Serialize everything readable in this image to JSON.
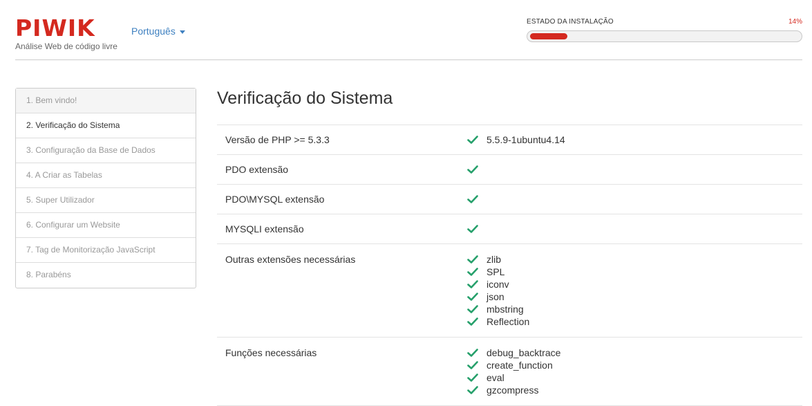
{
  "header": {
    "logo_text": "PIWIK",
    "tagline": "Análise Web de código livre",
    "language": "Português"
  },
  "progress": {
    "label": "ESTADO DA INSTALAÇÃO",
    "percent_text": "14%",
    "value": 0.14
  },
  "colors": {
    "brand": "#d4291f",
    "check": "#26a06b",
    "link": "#3e80c0"
  },
  "steps": [
    "1. Bem vindo!",
    "2. Verificação do Sistema",
    "3. Configuração da Base de Dados",
    "4. A Criar as Tabelas",
    "5. Super Utilizador",
    "6. Configurar um Website",
    "7. Tag de Monitorização JavaScript",
    "8. Parabéns"
  ],
  "page_title": "Verificação do Sistema",
  "checks": [
    {
      "label": "Versão de PHP >= 5.3.3",
      "values": [
        "5.5.9-1ubuntu4.14"
      ]
    },
    {
      "label": "PDO extensão",
      "values": [
        ""
      ]
    },
    {
      "label": "PDO\\MYSQL extensão",
      "values": [
        ""
      ]
    },
    {
      "label": "MYSQLI extensão",
      "values": [
        ""
      ]
    },
    {
      "label": "Outras extensões necessárias",
      "values": [
        "zlib",
        "SPL",
        "iconv",
        "json",
        "mbstring",
        "Reflection"
      ]
    },
    {
      "label": "Funções necessárias",
      "values": [
        "debug_backtrace",
        "create_function",
        "eval",
        "gzcompress"
      ]
    }
  ]
}
